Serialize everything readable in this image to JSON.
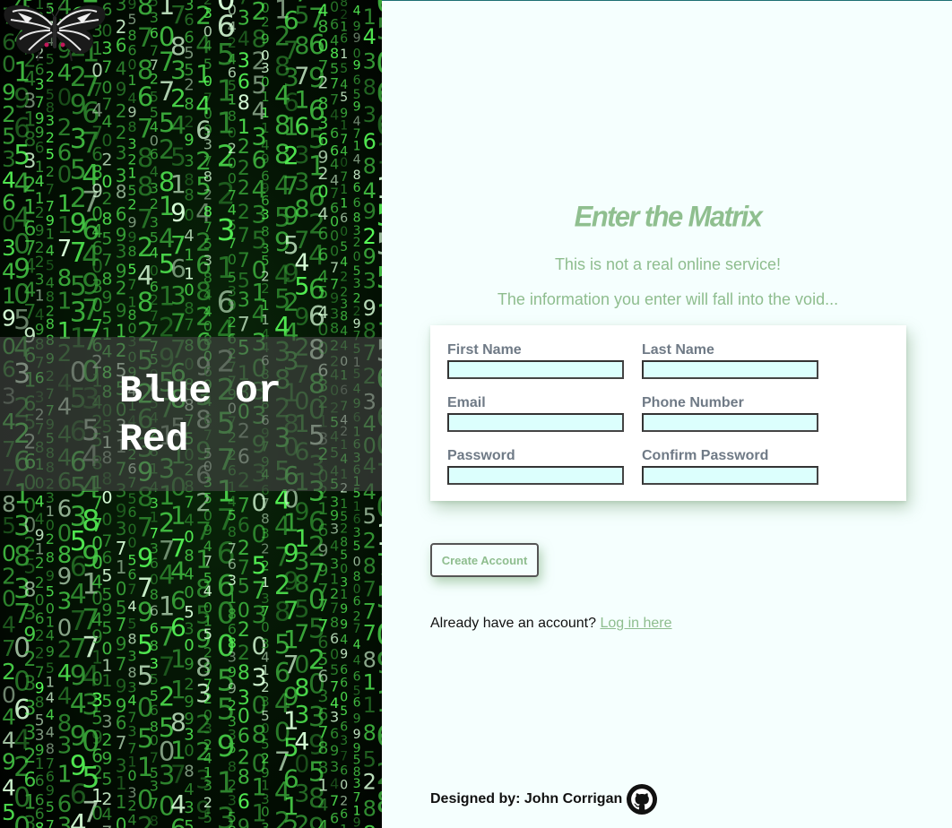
{
  "sidebar": {
    "brand_text": "Blue or\nRed"
  },
  "main": {
    "title": "Enter the Matrix",
    "subtitle_1": "This is not a real online service!",
    "subtitle_2": "The information you enter will fall into the void...",
    "form": {
      "first_name_label": "First Name",
      "last_name_label": "Last Name",
      "email_label": "Email",
      "phone_label": "Phone Number",
      "password_label": "Password",
      "confirm_password_label": "Confirm Password",
      "first_name_value": "",
      "last_name_value": "",
      "email_value": "",
      "phone_value": "",
      "password_value": "",
      "confirm_password_value": ""
    },
    "create_button_label": "Create Account",
    "login_prompt": "Already have an account?",
    "login_link": "Log in here",
    "footer_text": "Designed by: John Corrigan"
  },
  "colors": {
    "accent_green": "#8ebd8e",
    "page_background": "#f5fffe",
    "input_background": "#dcfffd",
    "label_gray": "#6f7a86"
  },
  "icons": {
    "logo": "butterfly-icon",
    "footer": "github-icon"
  }
}
